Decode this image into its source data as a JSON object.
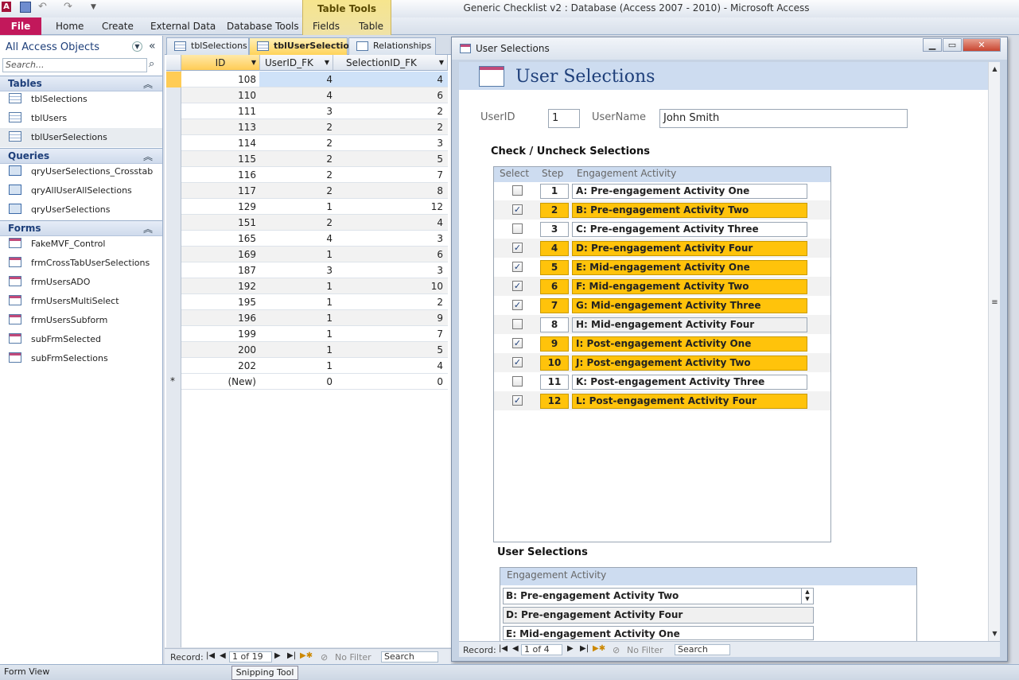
{
  "app": {
    "title": "Generic Checklist v2 : Database (Access 2007 - 2010)  -  Microsoft Access",
    "icon_letter": "A",
    "contextual_group": "Table Tools"
  },
  "ribbon": {
    "tabs": [
      "File",
      "Home",
      "Create",
      "External Data",
      "Database Tools",
      "Fields",
      "Table"
    ]
  },
  "nav": {
    "title": "All Access Objects",
    "search_placeholder": "Search...",
    "sections": [
      {
        "label": "Tables",
        "items": [
          "tblSelections",
          "tblUsers",
          "tblUserSelections"
        ]
      },
      {
        "label": "Queries",
        "items": [
          "qryUserSelections_Crosstab",
          "qryAllUserAllSelections",
          "qryUserSelections"
        ]
      },
      {
        "label": "Forms",
        "items": [
          "FakeMVF_Control",
          "frmCrossTabUserSelections",
          "frmUsersADO",
          "frmUsersMultiSelect",
          "frmUsersSubform",
          "subFrmSelected",
          "subFrmSelections"
        ]
      }
    ],
    "selected_item": "tblUserSelections"
  },
  "doc_tabs": [
    "tblSelections",
    "tblUserSelections",
    "Relationships"
  ],
  "datasheet": {
    "columns": [
      "ID",
      "UserID_FK",
      "SelectionID_FK"
    ],
    "rows": [
      [
        "108",
        "4",
        "4"
      ],
      [
        "110",
        "4",
        "6"
      ],
      [
        "111",
        "3",
        "2"
      ],
      [
        "113",
        "2",
        "2"
      ],
      [
        "114",
        "2",
        "3"
      ],
      [
        "115",
        "2",
        "5"
      ],
      [
        "116",
        "2",
        "7"
      ],
      [
        "117",
        "2",
        "8"
      ],
      [
        "129",
        "1",
        "12"
      ],
      [
        "151",
        "2",
        "4"
      ],
      [
        "165",
        "4",
        "3"
      ],
      [
        "169",
        "1",
        "6"
      ],
      [
        "187",
        "3",
        "3"
      ],
      [
        "192",
        "1",
        "10"
      ],
      [
        "195",
        "1",
        "2"
      ],
      [
        "196",
        "1",
        "9"
      ],
      [
        "199",
        "1",
        "7"
      ],
      [
        "200",
        "1",
        "5"
      ],
      [
        "202",
        "1",
        "4"
      ]
    ],
    "new_row": [
      "(New)",
      "0",
      "0"
    ],
    "new_row_marker": "*",
    "record_nav": {
      "label": "Record:",
      "position": "1 of 19",
      "filter": "No Filter",
      "search": "Search"
    }
  },
  "form": {
    "window_title": "User Selections",
    "header_title": "User Selections",
    "userid_label": "UserID",
    "userid_value": "1",
    "username_label": "UserName",
    "username_value": "John Smith",
    "checklist_heading": "Check / Uncheck Selections",
    "checklist_columns": [
      "Select",
      "Step",
      "Engagement  Activity"
    ],
    "checklist": [
      {
        "step": "1",
        "activity": "A: Pre-engagement Activity One",
        "checked": false
      },
      {
        "step": "2",
        "activity": "B: Pre-engagement Activity Two",
        "checked": true
      },
      {
        "step": "3",
        "activity": "C: Pre-engagement Activity Three",
        "checked": false
      },
      {
        "step": "4",
        "activity": "D: Pre-engagement Activity Four",
        "checked": true
      },
      {
        "step": "5",
        "activity": "E: Mid-engagement Activity One",
        "checked": true
      },
      {
        "step": "6",
        "activity": "F: Mid-engagement Activity Two",
        "checked": true
      },
      {
        "step": "7",
        "activity": "G: Mid-engagement Activity Three",
        "checked": true
      },
      {
        "step": "8",
        "activity": "H: Mid-engagement Activity Four",
        "checked": false
      },
      {
        "step": "9",
        "activity": "I: Post-engagement Activity One",
        "checked": true
      },
      {
        "step": "10",
        "activity": "J: Post-engagement Activity Two",
        "checked": true
      },
      {
        "step": "11",
        "activity": "K: Post-engagement Activity Three",
        "checked": false
      },
      {
        "step": "12",
        "activity": "L: Post-engagement Activity Four",
        "checked": true
      }
    ],
    "selections_heading": "User Selections",
    "selections_column": "Engagement  Activity",
    "selections": [
      "B: Pre-engagement Activity Two",
      "D: Pre-engagement Activity Four",
      "E: Mid-engagement Activity One"
    ],
    "record_nav": {
      "label": "Record:",
      "position": "1 of 4",
      "filter": "No Filter",
      "search": "Search"
    }
  },
  "status": {
    "view": "Form View",
    "taskbar_item": "Snipping Tool"
  },
  "colors": {
    "file_tab": "#c2185b",
    "highlight": "#ffc30b",
    "header_band": "#cddcf0"
  }
}
